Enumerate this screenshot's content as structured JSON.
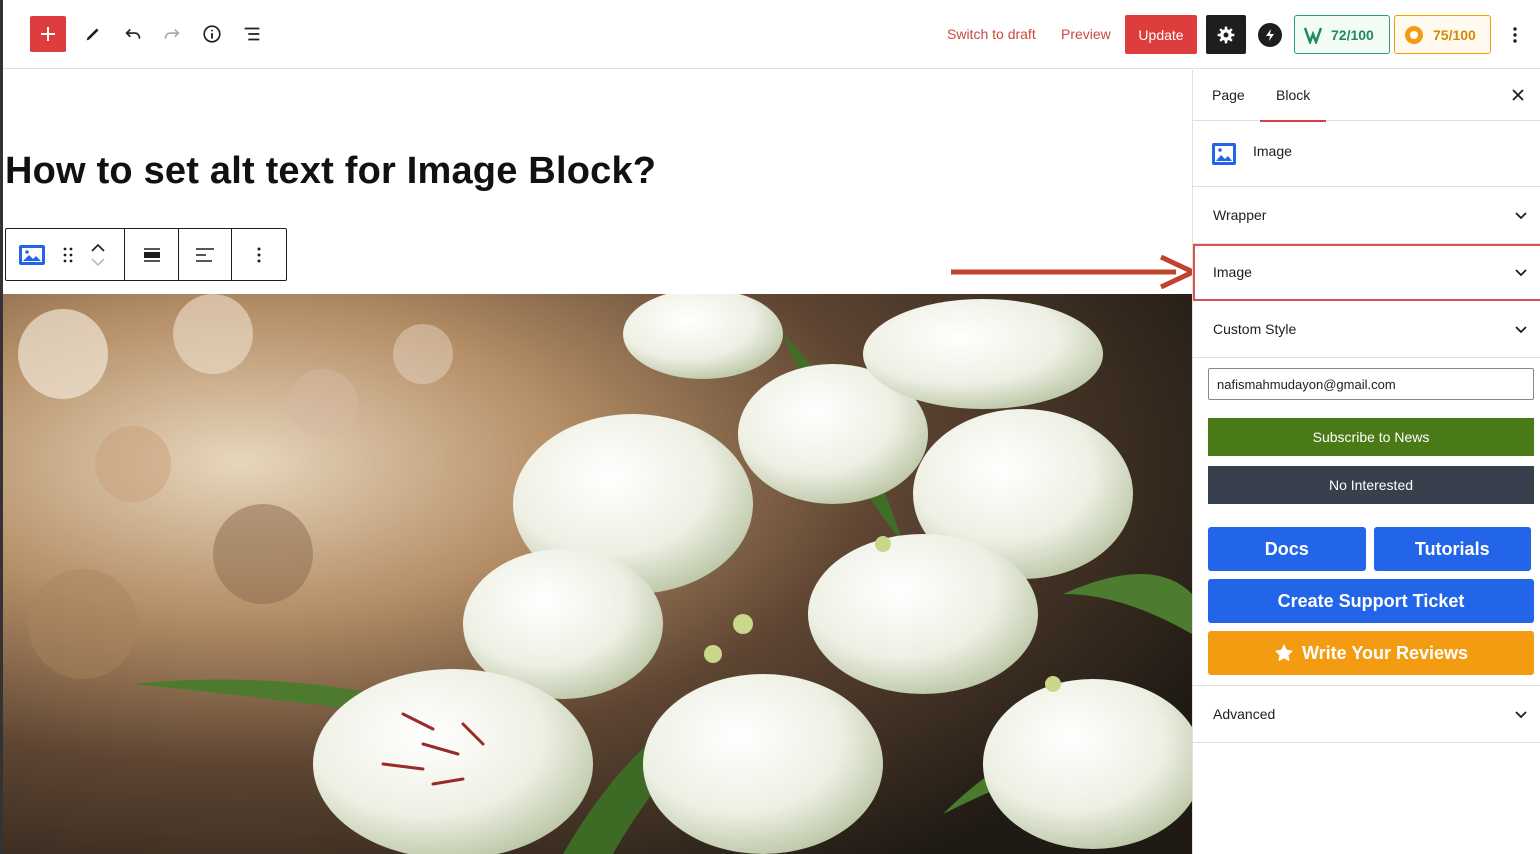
{
  "toolbar": {
    "switch_to_draft": "Switch to draft",
    "preview": "Preview",
    "update": "Update",
    "score_seo": "72/100",
    "score_readability": "75/100"
  },
  "editor": {
    "title": "How to set alt text for Image Block?"
  },
  "sidebar": {
    "tabs": [
      {
        "label": "Page"
      },
      {
        "label": "Block"
      }
    ],
    "block_name": "Image",
    "panels": [
      {
        "label": "Wrapper"
      },
      {
        "label": "Image"
      },
      {
        "label": "Custom Style"
      },
      {
        "label": "Advanced"
      }
    ],
    "promo": {
      "email_value": "nafismahmudayon@gmail.com",
      "subscribe": "Subscribe to News",
      "not_interested": "No Interested",
      "docs": "Docs",
      "tutorials": "Tutorials",
      "support": "Create Support Ticket",
      "reviews": "Write Your Reviews"
    }
  },
  "colors": {
    "accent": "#dd3d3d",
    "subscribe": "#4a7a16",
    "dark": "#38404d",
    "blue": "#2265e8",
    "orange": "#f39c12"
  }
}
